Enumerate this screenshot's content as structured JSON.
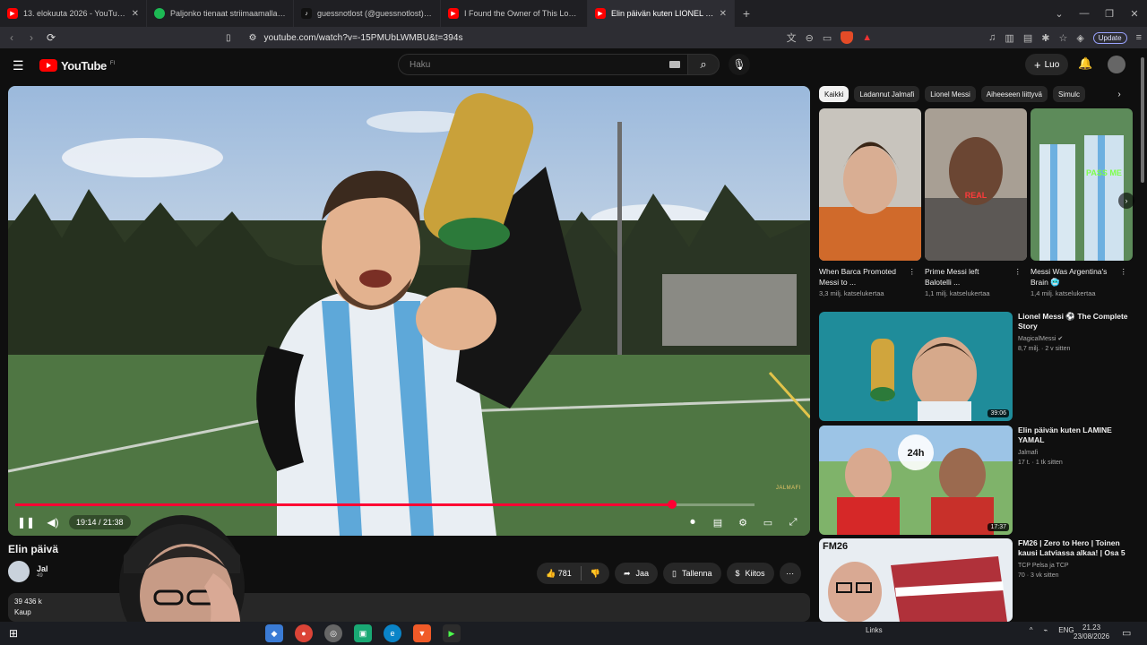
{
  "browser": {
    "tabs": [
      {
        "title": "13. elokuuta 2026 - YouTube",
        "icon": "youtube-icon",
        "color": "#ff0000"
      },
      {
        "title": "Paljonko tienaat striimaamalla? - La",
        "icon": "spotify-icon",
        "color": "#1db954"
      },
      {
        "title": "guessnotlost (@guessnotlost) | TikTok",
        "icon": "tiktok-icon",
        "color": "#111111"
      },
      {
        "title": "I Found the Owner of This Lost Phone",
        "icon": "youtube-icon",
        "color": "#ff0000"
      },
      {
        "title": "Elin päivän kuten LIONEL ME",
        "icon": "youtube-icon",
        "color": "#ff0000"
      }
    ],
    "url": "youtube.com/watch?v=-15PMUbLWMBU&t=394s",
    "update_label": "Update"
  },
  "youtube": {
    "logo_text": "YouTube",
    "country_code": "FI",
    "search_placeholder": "Haku",
    "create_label": "Luo"
  },
  "player": {
    "time": "19:14 / 21:38",
    "progress": 0.889,
    "watermark": "JALMAFI"
  },
  "video": {
    "title": "Elin päivä",
    "channel_name": "Jal",
    "channel_subs": "49",
    "like_count": "781",
    "share_label": "Jaa",
    "save_label": "Tallenna",
    "thanks_label": "Kiitos",
    "desc_views": "39 436 k",
    "desc_line2": "Kaup"
  },
  "sidebar": {
    "chips": [
      "Kaikki",
      "Ladannut Jalmafi",
      "Lionel Messi",
      "Aiheeseen liittyvä",
      "Simulc"
    ],
    "shorts": [
      {
        "title": "When Barca Promoted Messi to ...",
        "views": "3,3 milj. katselukertaa",
        "bg": "#c45a2e"
      },
      {
        "title": "Prime Messi left Balotelli ...",
        "views": "1,1 milj. katselukertaa",
        "bg": "#6a6360"
      },
      {
        "title": "Messi Was Argentina's Brain 🥶",
        "views": "1,4 milj. katselukertaa",
        "bg": "#4f7a4b"
      }
    ],
    "recs": [
      {
        "title": "Lionel Messi ⚽ The Complete Story",
        "channel": "MagicalMessi ✔",
        "views": "8,7 milj. · 2 v sitten",
        "duration": "39:06",
        "bg": "#1a7a8a"
      },
      {
        "title": "Elin päivän kuten LAMINE YAMAL",
        "channel": "Jalmafi",
        "views": "17 t. · 1 tk sitten",
        "duration": "17:37",
        "bg": "#3a8f3f"
      },
      {
        "title": "FM26 | Zero to Hero | Toinen kausi Latviassa alkaa! | Osa 5",
        "channel": "TCP Pelsa ja TCP",
        "views": "70 · 3 vk sitten",
        "duration": "",
        "bg": "#cfd6de"
      }
    ]
  },
  "taskbar": {
    "links_label": "Links",
    "lang": "ENG",
    "time": "21.23",
    "date": "23/08/2026"
  }
}
